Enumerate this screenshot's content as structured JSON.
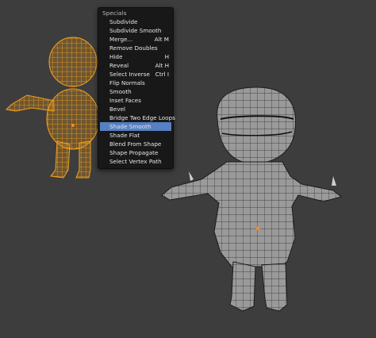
{
  "menu": {
    "title": "Specials",
    "items": [
      {
        "label": "Subdivide",
        "shortcut": ""
      },
      {
        "label": "Subdivide Smooth",
        "shortcut": ""
      },
      {
        "label": "Merge...",
        "shortcut": "Alt M"
      },
      {
        "label": "Remove Doubles",
        "shortcut": ""
      },
      {
        "label": "Hide",
        "shortcut": "H"
      },
      {
        "label": "Reveal",
        "shortcut": "Alt H"
      },
      {
        "label": "Select Inverse",
        "shortcut": "Ctrl I"
      },
      {
        "label": "Flip Normals",
        "shortcut": ""
      },
      {
        "label": "Smooth",
        "shortcut": ""
      },
      {
        "label": "Inset Faces",
        "shortcut": ""
      },
      {
        "label": "Bevel",
        "shortcut": ""
      },
      {
        "label": "Bridge Two Edge Loops",
        "shortcut": ""
      },
      {
        "label": "Shade Smooth",
        "shortcut": "",
        "highlighted": true
      },
      {
        "label": "Shade Flat",
        "shortcut": ""
      },
      {
        "label": "Blend From Shape",
        "shortcut": ""
      },
      {
        "label": "Shape Propagate",
        "shortcut": ""
      },
      {
        "label": "Select Vertex Path",
        "shortcut": ""
      }
    ]
  },
  "colors": {
    "background": "#3d3d3d",
    "menu_bg": "#181818",
    "highlight": "#5680c2",
    "selected_wire": "#f5a21f",
    "mesh_gray": "#9a9a9a"
  }
}
